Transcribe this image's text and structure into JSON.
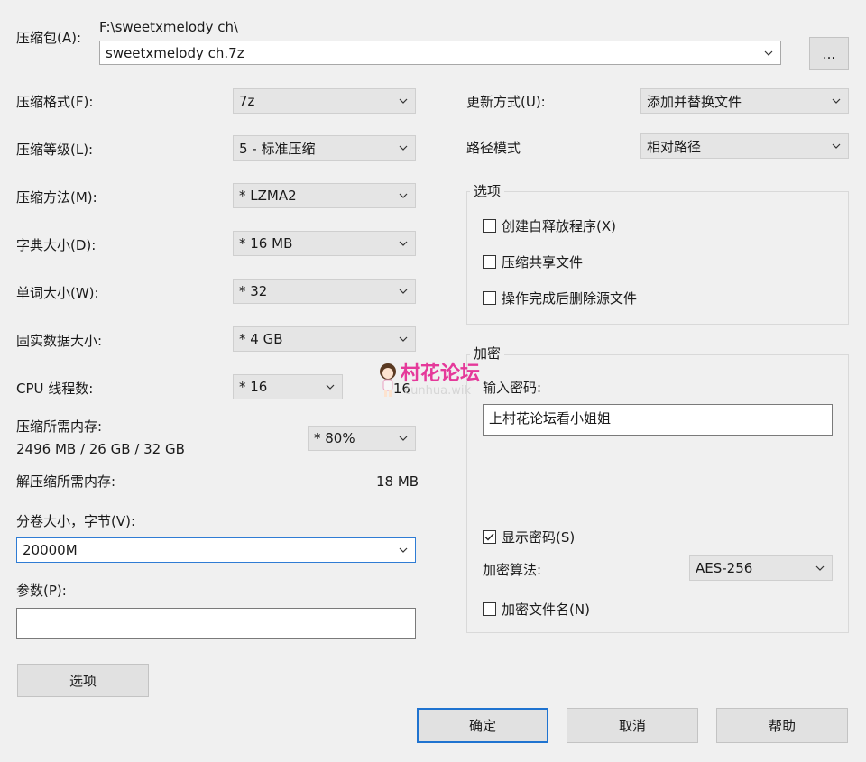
{
  "archive": {
    "label": "压缩包(A):",
    "path": "F:\\sweetxmelody ch\\",
    "filename": "sweetxmelody ch.7z",
    "browse_label": "..."
  },
  "left": {
    "format_label": "压缩格式(F):",
    "format_value": "7z",
    "level_label": "压缩等级(L):",
    "level_value": "5 - 标准压缩",
    "method_label": "压缩方法(M):",
    "method_value": "*  LZMA2",
    "dict_label": "字典大小(D):",
    "dict_value": "*  16 MB",
    "word_label": "单词大小(W):",
    "word_value": "*  32",
    "solid_label": "固实数据大小:",
    "solid_value": "*  4 GB",
    "cpu_label": "CPU 线程数:",
    "cpu_value": "*  16",
    "cpu_max": "/ 16",
    "mem_label": "压缩所需内存:",
    "mem_value": "2496 MB / 26 GB / 32 GB",
    "mem_percent": "* 80%",
    "decomp_label": "解压缩所需内存:",
    "decomp_value": "18 MB",
    "split_label": "分卷大小，字节(V):",
    "split_value": "20000M",
    "params_label": "参数(P):",
    "params_value": "",
    "options_button": "选项"
  },
  "right": {
    "update_label": "更新方式(U):",
    "update_value": "添加并替换文件",
    "path_label": "路径模式",
    "path_value": "相对路径",
    "options_group": "选项",
    "opt_sfx": "创建自释放程序(X)",
    "opt_shared": "压缩共享文件",
    "opt_delete": "操作完成后删除源文件",
    "encrypt_group": "加密",
    "password_label": "输入密码:",
    "password_value": "上村花论坛看小姐姐",
    "show_password": "显示密码(S)",
    "algo_label": "加密算法:",
    "algo_value": "AES-256",
    "encrypt_names": "加密文件名(N)"
  },
  "buttons": {
    "ok": "确定",
    "cancel": "取消",
    "help": "帮助"
  },
  "watermark": {
    "text": "村花论坛",
    "sub": "cunhua.wik"
  },
  "colors": {
    "background": "#f0f0f0",
    "focus_border": "#2f7cd4",
    "watermark": "#e5399a"
  }
}
